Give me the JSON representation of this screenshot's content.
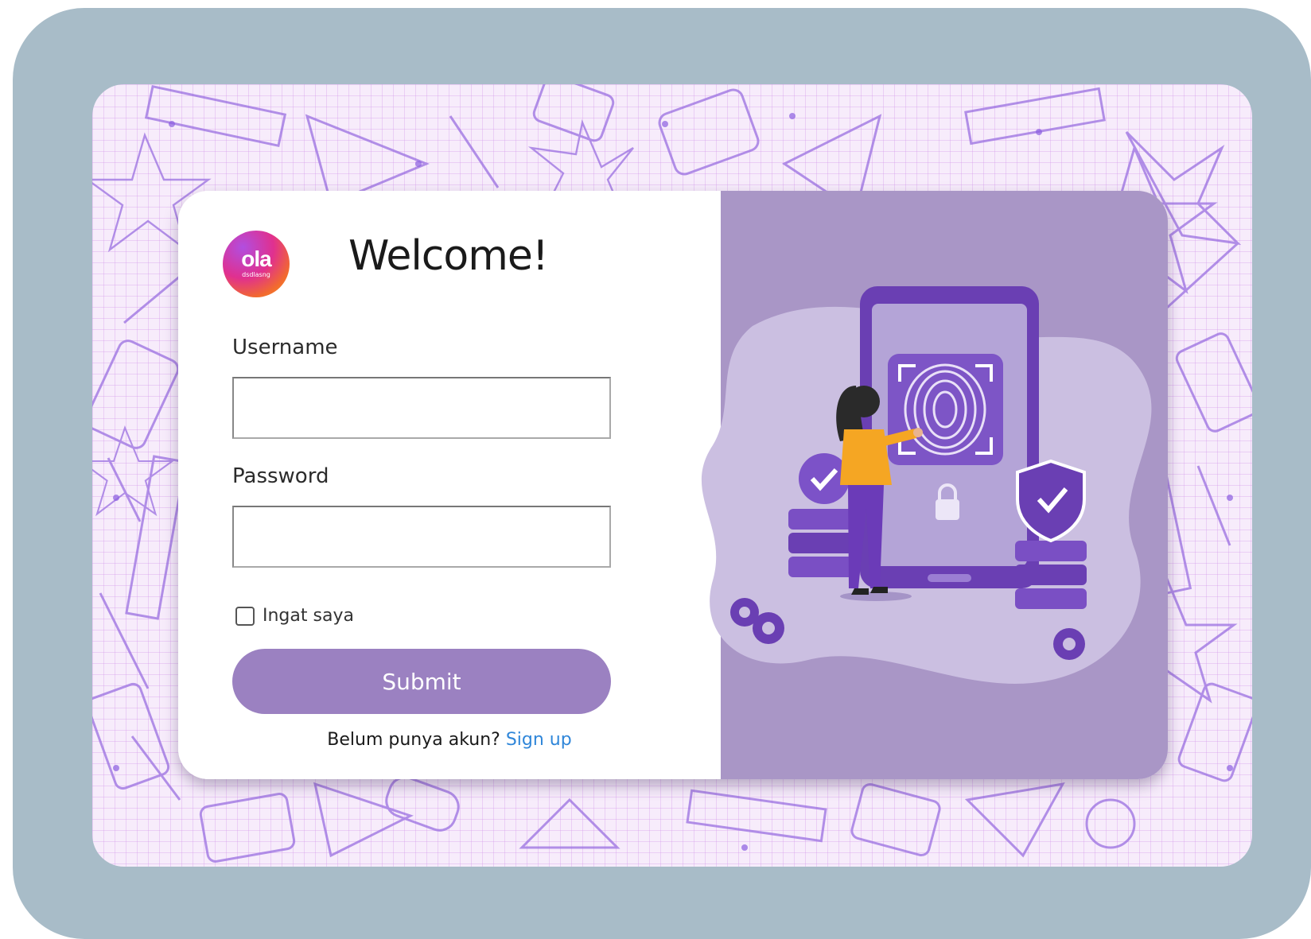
{
  "login": {
    "logo": {
      "brand": "ola",
      "sub": "dsdlasng"
    },
    "title": "Welcome!",
    "username_label": "Username",
    "username_value": "",
    "password_label": "Password",
    "password_value": "",
    "remember_label": "Ingat saya",
    "submit_label": "Submit",
    "signup_prompt": "Belum punya akun?",
    "signup_link": "Sign up"
  },
  "colors": {
    "frame": "#a8bcc8",
    "panel": "#a996c6",
    "button": "#9b81c1",
    "link": "#2f86d9"
  },
  "illustration": {
    "icons": [
      "phone-icon",
      "fingerprint-icon",
      "lock-icon",
      "shield-check-icon",
      "server-icon",
      "gear-icon",
      "person-figure"
    ]
  }
}
